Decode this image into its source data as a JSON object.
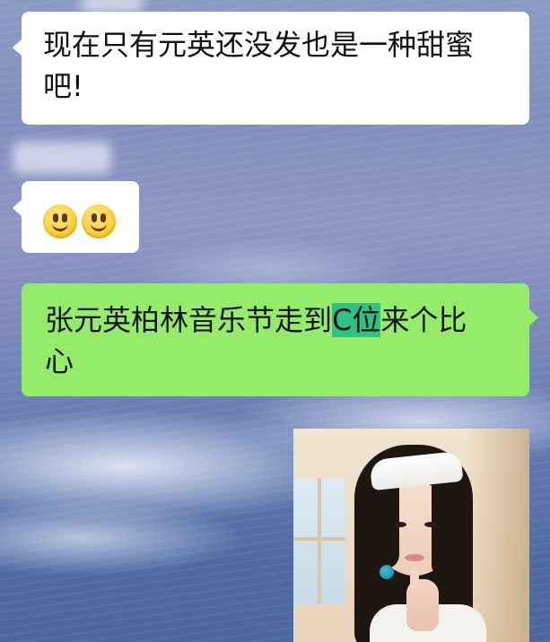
{
  "chat": {
    "messages": [
      {
        "side": "left",
        "type": "text",
        "text_line1": "现在只有元英还没发也是一种甜蜜",
        "text_line2": "吧!"
      },
      {
        "side": "left",
        "type": "emoji",
        "emoji": [
          "smile-icon",
          "smile-icon"
        ]
      },
      {
        "side": "right",
        "type": "text",
        "text_pre": "张元英柏林音乐节走到",
        "text_highlight": "C位",
        "text_post": "来个比",
        "text_line2": "心"
      },
      {
        "side": "right",
        "type": "image",
        "description_icon": "photo-thumbnail"
      }
    ]
  },
  "colors": {
    "bubble_left": "#ffffff",
    "bubble_right": "#95ec69",
    "selection_highlight": "#2fc383"
  }
}
